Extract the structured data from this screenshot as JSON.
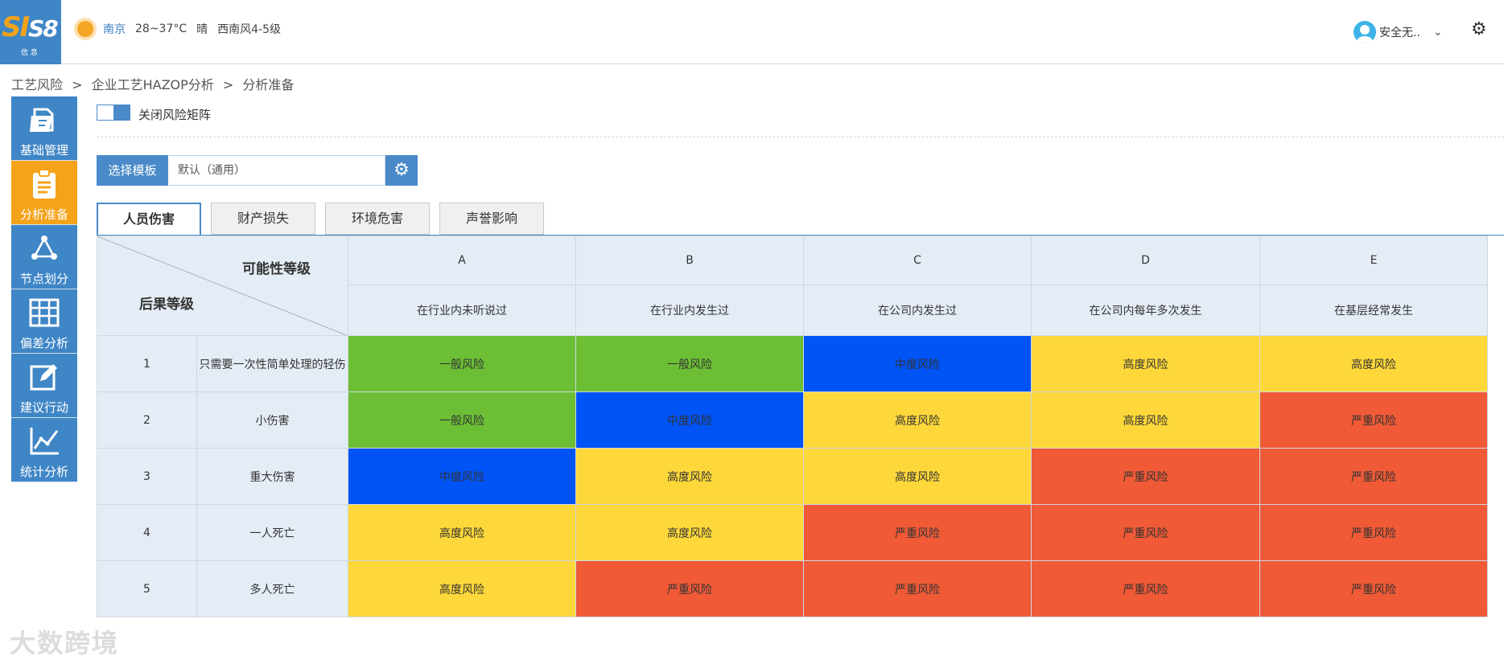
{
  "header": {
    "logo_text": "SI",
    "logo_text2": "S8",
    "logo_sub": "信 息",
    "weather": {
      "city": "南京",
      "temp": "28~37°C",
      "condition": "晴",
      "wind": "西南风4-5级"
    },
    "user_name": "安全无.."
  },
  "breadcrumb": [
    "工艺风险",
    ">",
    "企业工艺HAZOP分析",
    ">",
    "分析准备"
  ],
  "sidebar": {
    "items": [
      {
        "label": "基础管理",
        "icon": "folder-icon"
      },
      {
        "label": "分析准备",
        "icon": "clipboard-icon"
      },
      {
        "label": "节点划分",
        "icon": "node-graph-icon"
      },
      {
        "label": "偏差分析",
        "icon": "grid-icon"
      },
      {
        "label": "建议行动",
        "icon": "edit-icon"
      },
      {
        "label": "统计分析",
        "icon": "chart-icon"
      }
    ]
  },
  "toggle_label": "关闭风险矩阵",
  "template": {
    "label": "选择模板",
    "value": "默认（通用）"
  },
  "tabs": [
    "人员伤害",
    "财产损失",
    "环境危害",
    "声誉影响"
  ],
  "matrix": {
    "likelihood_title": "可能性等级",
    "consequence_title": "后果等级",
    "columns": [
      {
        "code": "A",
        "desc": "在行业内未听说过"
      },
      {
        "code": "B",
        "desc": "在行业内发生过"
      },
      {
        "code": "C",
        "desc": "在公司内发生过"
      },
      {
        "code": "D",
        "desc": "在公司内每年多次发生"
      },
      {
        "code": "E",
        "desc": "在基层经常发生"
      }
    ],
    "rows": [
      {
        "level": "1",
        "desc": "只需要一次性简单处理的轻伤",
        "cells": [
          "一般风险",
          "一般风险",
          "中度风险",
          "高度风险",
          "高度风险"
        ]
      },
      {
        "level": "2",
        "desc": "小伤害",
        "cells": [
          "一般风险",
          "中度风险",
          "高度风险",
          "高度风险",
          "严重风险"
        ]
      },
      {
        "level": "3",
        "desc": "重大伤害",
        "cells": [
          "中度风险",
          "高度风险",
          "高度风险",
          "严重风险",
          "严重风险"
        ]
      },
      {
        "level": "4",
        "desc": "一人死亡",
        "cells": [
          "高度风险",
          "高度风险",
          "严重风险",
          "严重风险",
          "严重风险"
        ]
      },
      {
        "level": "5",
        "desc": "多人死亡",
        "cells": [
          "高度风险",
          "严重风险",
          "严重风险",
          "严重风险",
          "严重风险"
        ]
      }
    ],
    "colors": {
      "一般风险": "#6cbf35",
      "中度风险": "#0053f5",
      "高度风险": "#fed83a",
      "严重风险": "#f05a36"
    }
  },
  "watermark": "大数跨境"
}
